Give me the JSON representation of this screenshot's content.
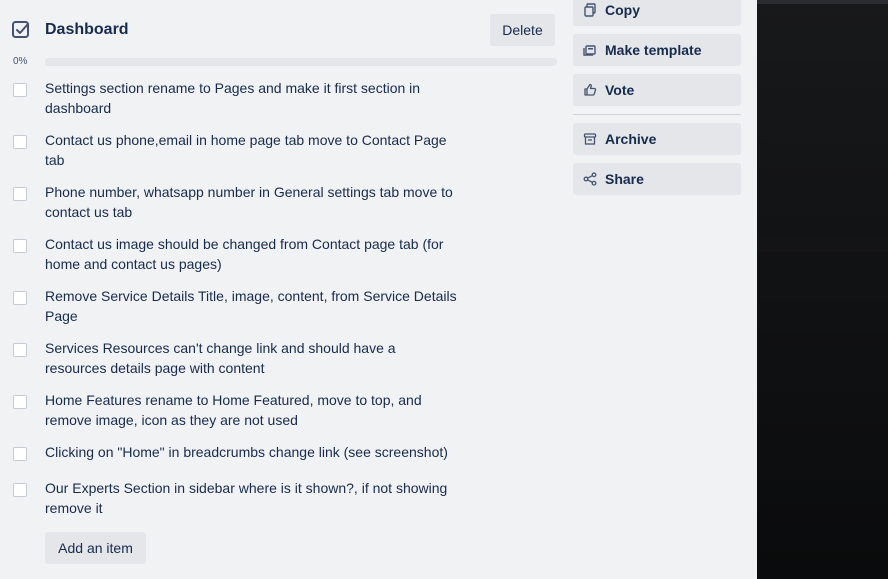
{
  "checklist": {
    "title": "Dashboard",
    "delete_label": "Delete",
    "progress_text": "0%",
    "progress_value": 0,
    "add_item_label": "Add an item",
    "items": [
      {
        "text": "Settings section rename to Pages and make it first section in dashboard",
        "checked": false
      },
      {
        "text": "Contact us phone,email in home page tab move to Contact Page tab",
        "checked": false
      },
      {
        "text": "Phone number, whatsapp number in General settings tab move to contact us tab",
        "checked": false
      },
      {
        "text": "Contact us image should be changed from Contact page tab (for home and contact us pages)",
        "checked": false
      },
      {
        "text": "Remove Service Details Title, image, content, from Service Details Page",
        "checked": false
      },
      {
        "text": "Services Resources can't change link and should have a resources details page with content",
        "checked": false
      },
      {
        "text": "Home Features rename to Home Featured, move to top, and remove image, icon as they are not used",
        "checked": false
      },
      {
        "text": "Clicking on \"Home\" in breadcrumbs change link (see screenshot)",
        "checked": false
      },
      {
        "text": "Our Experts Section in sidebar where is it shown?, if not showing remove it",
        "checked": false
      }
    ]
  },
  "actions": {
    "copy": {
      "label": "Copy",
      "icon": "copy-icon"
    },
    "make_template": {
      "label": "Make template",
      "icon": "template-icon"
    },
    "vote": {
      "label": "Vote",
      "icon": "thumbs-up-icon"
    },
    "archive": {
      "label": "Archive",
      "icon": "archive-icon"
    },
    "share": {
      "label": "Share",
      "icon": "share-icon"
    }
  },
  "colors": {
    "panel_bg": "#f1f2f4",
    "button_bg": "#e4e6ea",
    "text": "#172b4d",
    "progress_fill": "#1f845a"
  }
}
